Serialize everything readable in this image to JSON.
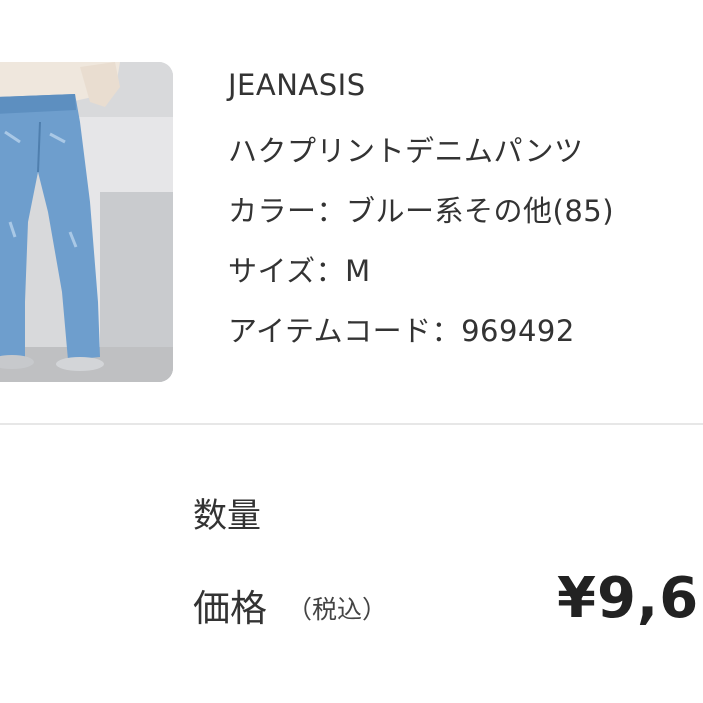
{
  "product": {
    "brand": "JEANASIS",
    "name": "ハクプリントデニムパンツ",
    "color_line": "カラー：ブルー系その他(85)",
    "size_line": "サイズ：M",
    "item_code_line": "アイテムコード：969492"
  },
  "summary": {
    "quantity_label": "数量",
    "price_label": "価格",
    "tax_note": "（税込）",
    "price_value": "¥9,6"
  },
  "colors": {
    "background": "#ffffff",
    "text": "#333333",
    "divider": "#e7e7e7",
    "denim": "#6e9ecd"
  }
}
